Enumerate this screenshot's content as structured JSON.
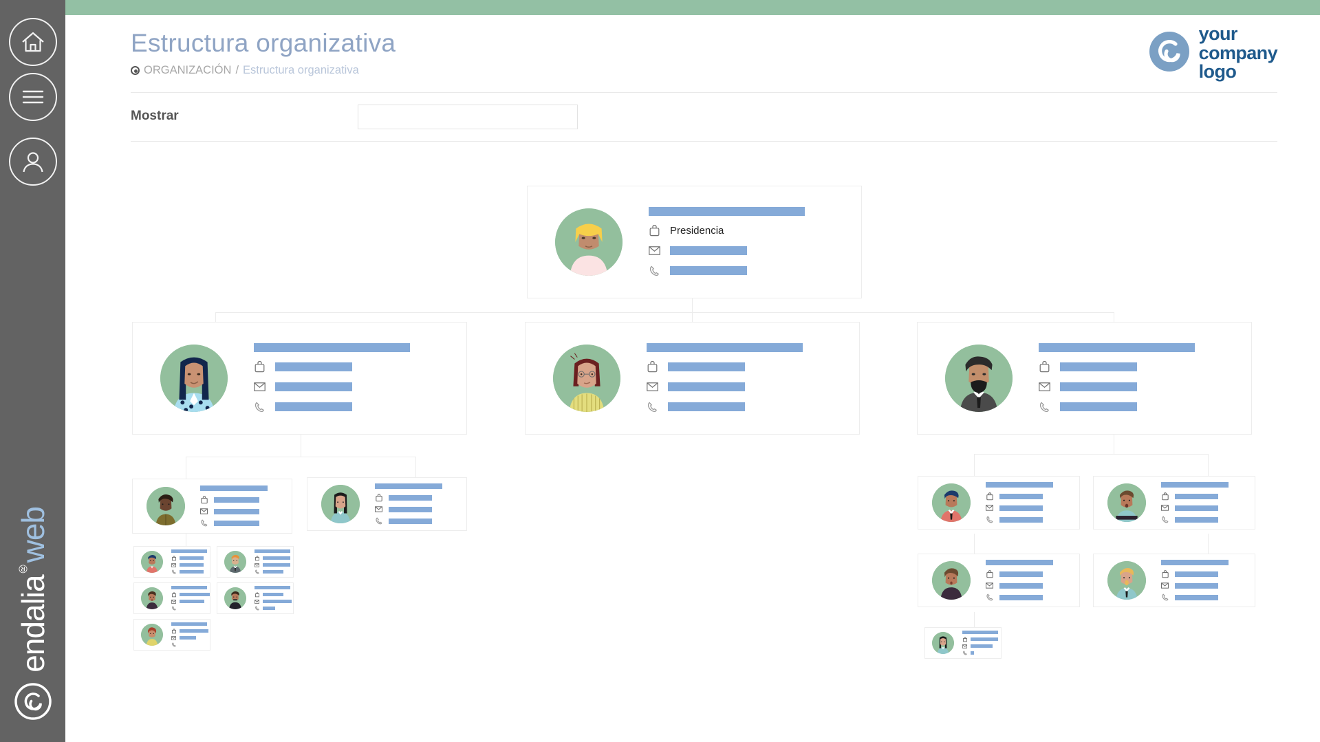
{
  "app": {
    "product_name_primary": "endalia",
    "product_name_secondary": "web",
    "registered_mark": "®"
  },
  "sidebar": {
    "items": [
      {
        "name": "home",
        "icon": "home-icon",
        "label": "Inicio"
      },
      {
        "name": "menu",
        "icon": "hamburger-menu-icon",
        "label": "Menú"
      },
      {
        "name": "profile",
        "icon": "user-profile-icon",
        "label": "Perfil"
      }
    ]
  },
  "header": {
    "title": "Estructura organizativa",
    "breadcrumb_root": "ORGANIZACIÓN",
    "breadcrumb_separator": "/",
    "breadcrumb_current": "Estructura organizativa",
    "logo_lines": [
      "your",
      "company",
      "logo"
    ],
    "logo_icon": "swirl-circle-logo-icon"
  },
  "filters": {
    "label": "Mostrar",
    "value": "",
    "placeholder": ""
  },
  "colors": {
    "topbar_green": "#93c0a4",
    "sidebar_gray": "#636363",
    "title_blue": "#8fa4c4",
    "redaction_blue": "#85aad8",
    "avatar_green": "#93bf9d",
    "logo_blue": "#1f5a8c",
    "connector_gray": "#ececec"
  },
  "chart_data": {
    "type": "org-chart",
    "title": "Estructura organizativa",
    "levels": 5,
    "total_nodes": 16,
    "nodes": [
      {
        "id": "n0",
        "level": 0,
        "parent": null,
        "size": "l",
        "job_title": "Presidencia",
        "job_redacted": false,
        "name_redacted": true,
        "email_redacted": true,
        "phone_redacted": true,
        "avatar": "avatar-blonde-woman"
      },
      {
        "id": "n1",
        "level": 1,
        "parent": "n0",
        "size": "l",
        "job_title": "",
        "job_redacted": true,
        "name_redacted": true,
        "email_redacted": true,
        "phone_redacted": true,
        "avatar": "avatar-dark-hair-woman-polka-dots"
      },
      {
        "id": "n2",
        "level": 1,
        "parent": "n0",
        "size": "l",
        "job_title": "",
        "job_redacted": true,
        "name_redacted": true,
        "email_redacted": true,
        "phone_redacted": true,
        "avatar": "avatar-redhead-woman-glasses"
      },
      {
        "id": "n3",
        "level": 1,
        "parent": "n0",
        "size": "l",
        "job_title": "",
        "job_redacted": true,
        "name_redacted": true,
        "email_redacted": true,
        "phone_redacted": true,
        "avatar": "avatar-bearded-man-suit"
      },
      {
        "id": "n4",
        "level": 2,
        "parent": "n1",
        "size": "m",
        "job_title": "",
        "job_redacted": true,
        "name_redacted": true,
        "email_redacted": true,
        "phone_redacted": true,
        "avatar": "avatar-man-olive-shirt"
      },
      {
        "id": "n5",
        "level": 2,
        "parent": "n1",
        "size": "m",
        "job_title": "",
        "job_redacted": true,
        "name_redacted": true,
        "email_redacted": true,
        "phone_redacted": true,
        "avatar": "avatar-woman-teal-top"
      },
      {
        "id": "n6",
        "level": 3,
        "parent": "n4",
        "size": "s",
        "job_title": "",
        "job_redacted": true,
        "name_redacted": true,
        "email_redacted": true,
        "phone_redacted": true,
        "avatar": "avatar-man-blue-hair-red-shirt"
      },
      {
        "id": "n7",
        "level": 3,
        "parent": "n4",
        "size": "s",
        "job_title": "",
        "job_redacted": true,
        "name_redacted": true,
        "email_redacted": true,
        "phone_redacted": true,
        "avatar": "avatar-orange-hair-man-suit"
      },
      {
        "id": "n8",
        "level": 3,
        "parent": "n4",
        "size": "s",
        "job_title": "",
        "job_redacted": true,
        "name_redacted": true,
        "email_redacted": true,
        "phone_redacted": true,
        "avatar": "avatar-woman-dark-purple-top"
      },
      {
        "id": "n9",
        "level": 3,
        "parent": "n4",
        "size": "s",
        "job_title": "",
        "job_redacted": true,
        "name_redacted": true,
        "email_redacted": true,
        "phone_redacted": true,
        "avatar": "avatar-man-dark-top"
      },
      {
        "id": "n10",
        "level": 3,
        "parent": "n4",
        "size": "s",
        "job_title": "",
        "job_redacted": true,
        "name_redacted": true,
        "email_redacted": true,
        "phone_redacted": true,
        "avatar": "avatar-red-hair-woman-yellow-top"
      },
      {
        "id": "n11",
        "level": 2,
        "parent": "n3",
        "size": "m",
        "job_title": "",
        "job_redacted": true,
        "name_redacted": true,
        "email_redacted": true,
        "phone_redacted": true,
        "avatar": "avatar-man-navy-hair-red-suit"
      },
      {
        "id": "n12",
        "level": 2,
        "parent": "n3",
        "size": "m",
        "job_title": "",
        "job_redacted": true,
        "name_redacted": true,
        "email_redacted": true,
        "phone_redacted": true,
        "avatar": "avatar-man-striped-shirt"
      },
      {
        "id": "n13",
        "level": 3,
        "parent": "n11",
        "size": "m",
        "job_title": "",
        "job_redacted": true,
        "name_redacted": true,
        "email_redacted": true,
        "phone_redacted": true,
        "avatar": "avatar-man-dark-purple-top"
      },
      {
        "id": "n14",
        "level": 3,
        "parent": "n12",
        "size": "m",
        "job_title": "",
        "job_redacted": true,
        "name_redacted": true,
        "email_redacted": true,
        "phone_redacted": true,
        "avatar": "avatar-blonde-man-beard-tie"
      },
      {
        "id": "n15",
        "level": 4,
        "parent": "n13",
        "size": "s",
        "job_title": "",
        "job_redacted": true,
        "name_redacted": true,
        "email_redacted": true,
        "phone_redacted": true,
        "avatar": "avatar-dark-hair-woman-teal"
      }
    ],
    "row_icons": [
      "briefcase-icon",
      "envelope-icon",
      "phone-icon"
    ]
  }
}
